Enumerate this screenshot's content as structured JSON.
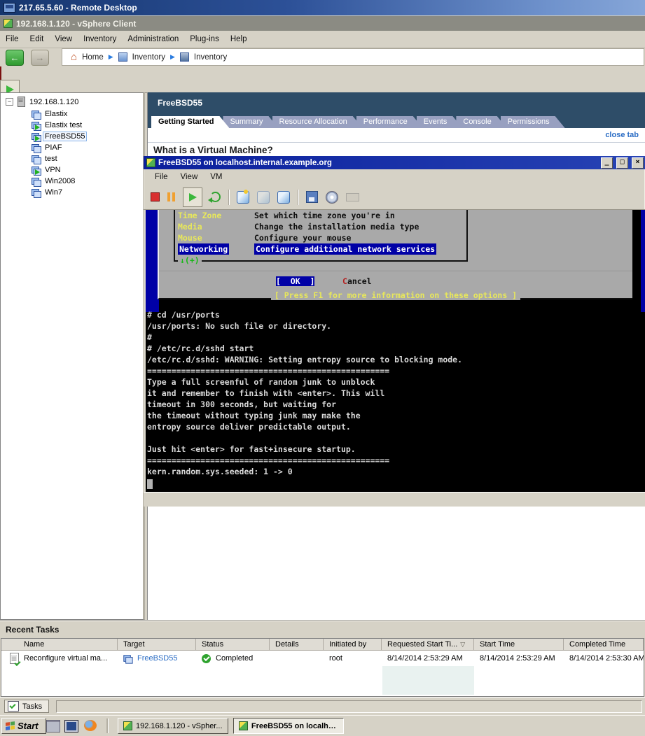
{
  "remote_desktop": {
    "title": "217.65.5.60 - Remote Desktop"
  },
  "vsphere": {
    "title": "192.168.1.120 - vSphere Client",
    "menu": [
      "File",
      "Edit",
      "View",
      "Inventory",
      "Administration",
      "Plug-ins",
      "Help"
    ],
    "breadcrumb": {
      "home": "Home",
      "level1": "Inventory",
      "level2": "Inventory"
    }
  },
  "icons": {
    "home_glyph": "⌂",
    "crumb_separator": "▶",
    "expander_collapse": "−",
    "sort_descending": "▽"
  },
  "tree": {
    "host": "192.168.1.120",
    "vms": [
      {
        "name": "Elastix",
        "running": false,
        "selected": false
      },
      {
        "name": "Elastix test",
        "running": true,
        "selected": false
      },
      {
        "name": "FreeBSD55",
        "running": true,
        "selected": true
      },
      {
        "name": "PIAF",
        "running": false,
        "selected": false
      },
      {
        "name": "test",
        "running": false,
        "selected": false
      },
      {
        "name": "VPN",
        "running": true,
        "selected": false
      },
      {
        "name": "Win2008",
        "running": false,
        "selected": false
      },
      {
        "name": "Win7",
        "running": false,
        "selected": false
      }
    ]
  },
  "content": {
    "vm_title": "FreeBSD55",
    "tabs": [
      {
        "label": "Getting Started",
        "active": true
      },
      {
        "label": "Summary",
        "active": false
      },
      {
        "label": "Resource Allocation",
        "active": false
      },
      {
        "label": "Performance",
        "active": false
      },
      {
        "label": "Events",
        "active": false
      },
      {
        "label": "Console",
        "active": false
      },
      {
        "label": "Permissions",
        "active": false
      }
    ],
    "close_tab": "close tab",
    "heading": "What is a Virtual Machine?"
  },
  "console_window": {
    "title": "FreeBSD55 on localhost.internal.example.org",
    "controls": {
      "minimize": "_",
      "maximize": "□",
      "close": "×"
    },
    "menu": [
      "File",
      "View",
      "VM"
    ],
    "dialog": {
      "items": [
        {
          "label": "Time Zone",
          "desc": "Set which time zone you're in",
          "selected": false
        },
        {
          "label": "Media",
          "desc": "Change the installation media type",
          "selected": false
        },
        {
          "label": "Mouse",
          "desc": "Configure your mouse",
          "selected": false
        },
        {
          "label": "Networking",
          "desc": "Configure additional network services",
          "selected": true
        }
      ],
      "scroll_indicator": "↓(+)",
      "ok_label": "[  OK  ]",
      "cancel_accel": "C",
      "cancel_rest": "ancel",
      "help_line": "[ Press F1 for more information on these options ]"
    },
    "terminal_lines": [
      "# cd /usr/ports",
      "/usr/ports: No such file or directory.",
      "#",
      "# /etc/rc.d/sshd start",
      "/etc/rc.d/sshd: WARNING: Setting entropy source to blocking mode.",
      "==================================================",
      "Type a full screenful of random junk to unblock",
      "it and remember to finish with <enter>. This will",
      "timeout in 300 seconds, but waiting for",
      "the timeout without typing junk may make the",
      "entropy source deliver predictable output.",
      "",
      "Just hit <enter> for fast+insecure startup.",
      "==================================================",
      "kern.random.sys.seeded: 1 -> 0"
    ]
  },
  "recent_tasks": {
    "title": "Recent Tasks",
    "columns": [
      "Name",
      "Target",
      "Status",
      "Details",
      "Initiated by",
      "Requested Start Ti...",
      "Start Time",
      "Completed Time"
    ],
    "row": {
      "name": "Reconfigure virtual ma...",
      "target": "FreeBSD55",
      "status": "Completed",
      "details": "",
      "initiated_by": "root",
      "requested_start_time": "8/14/2014 2:53:29 AM",
      "start_time": "8/14/2014 2:53:29 AM",
      "completed_time": "8/14/2014 2:53:30 AM"
    }
  },
  "status_bar": {
    "tasks_label": "Tasks"
  },
  "taskbar": {
    "start_label": "Start",
    "window_buttons": [
      "192.168.1.120 - vSpher...",
      "FreeBSD55 on localho..."
    ]
  },
  "colors": {
    "console_background": "#0000A6",
    "dialog_background": "#A9A9A9",
    "dialog_yellow": "#E8E85A",
    "dialog_highlight": "#0000A6",
    "titlebar_blue": "#2D5198",
    "inner_titlebar_blue": "#0A1F9C",
    "link_blue": "#2A6CC4",
    "status_green": "#2FA32F"
  }
}
